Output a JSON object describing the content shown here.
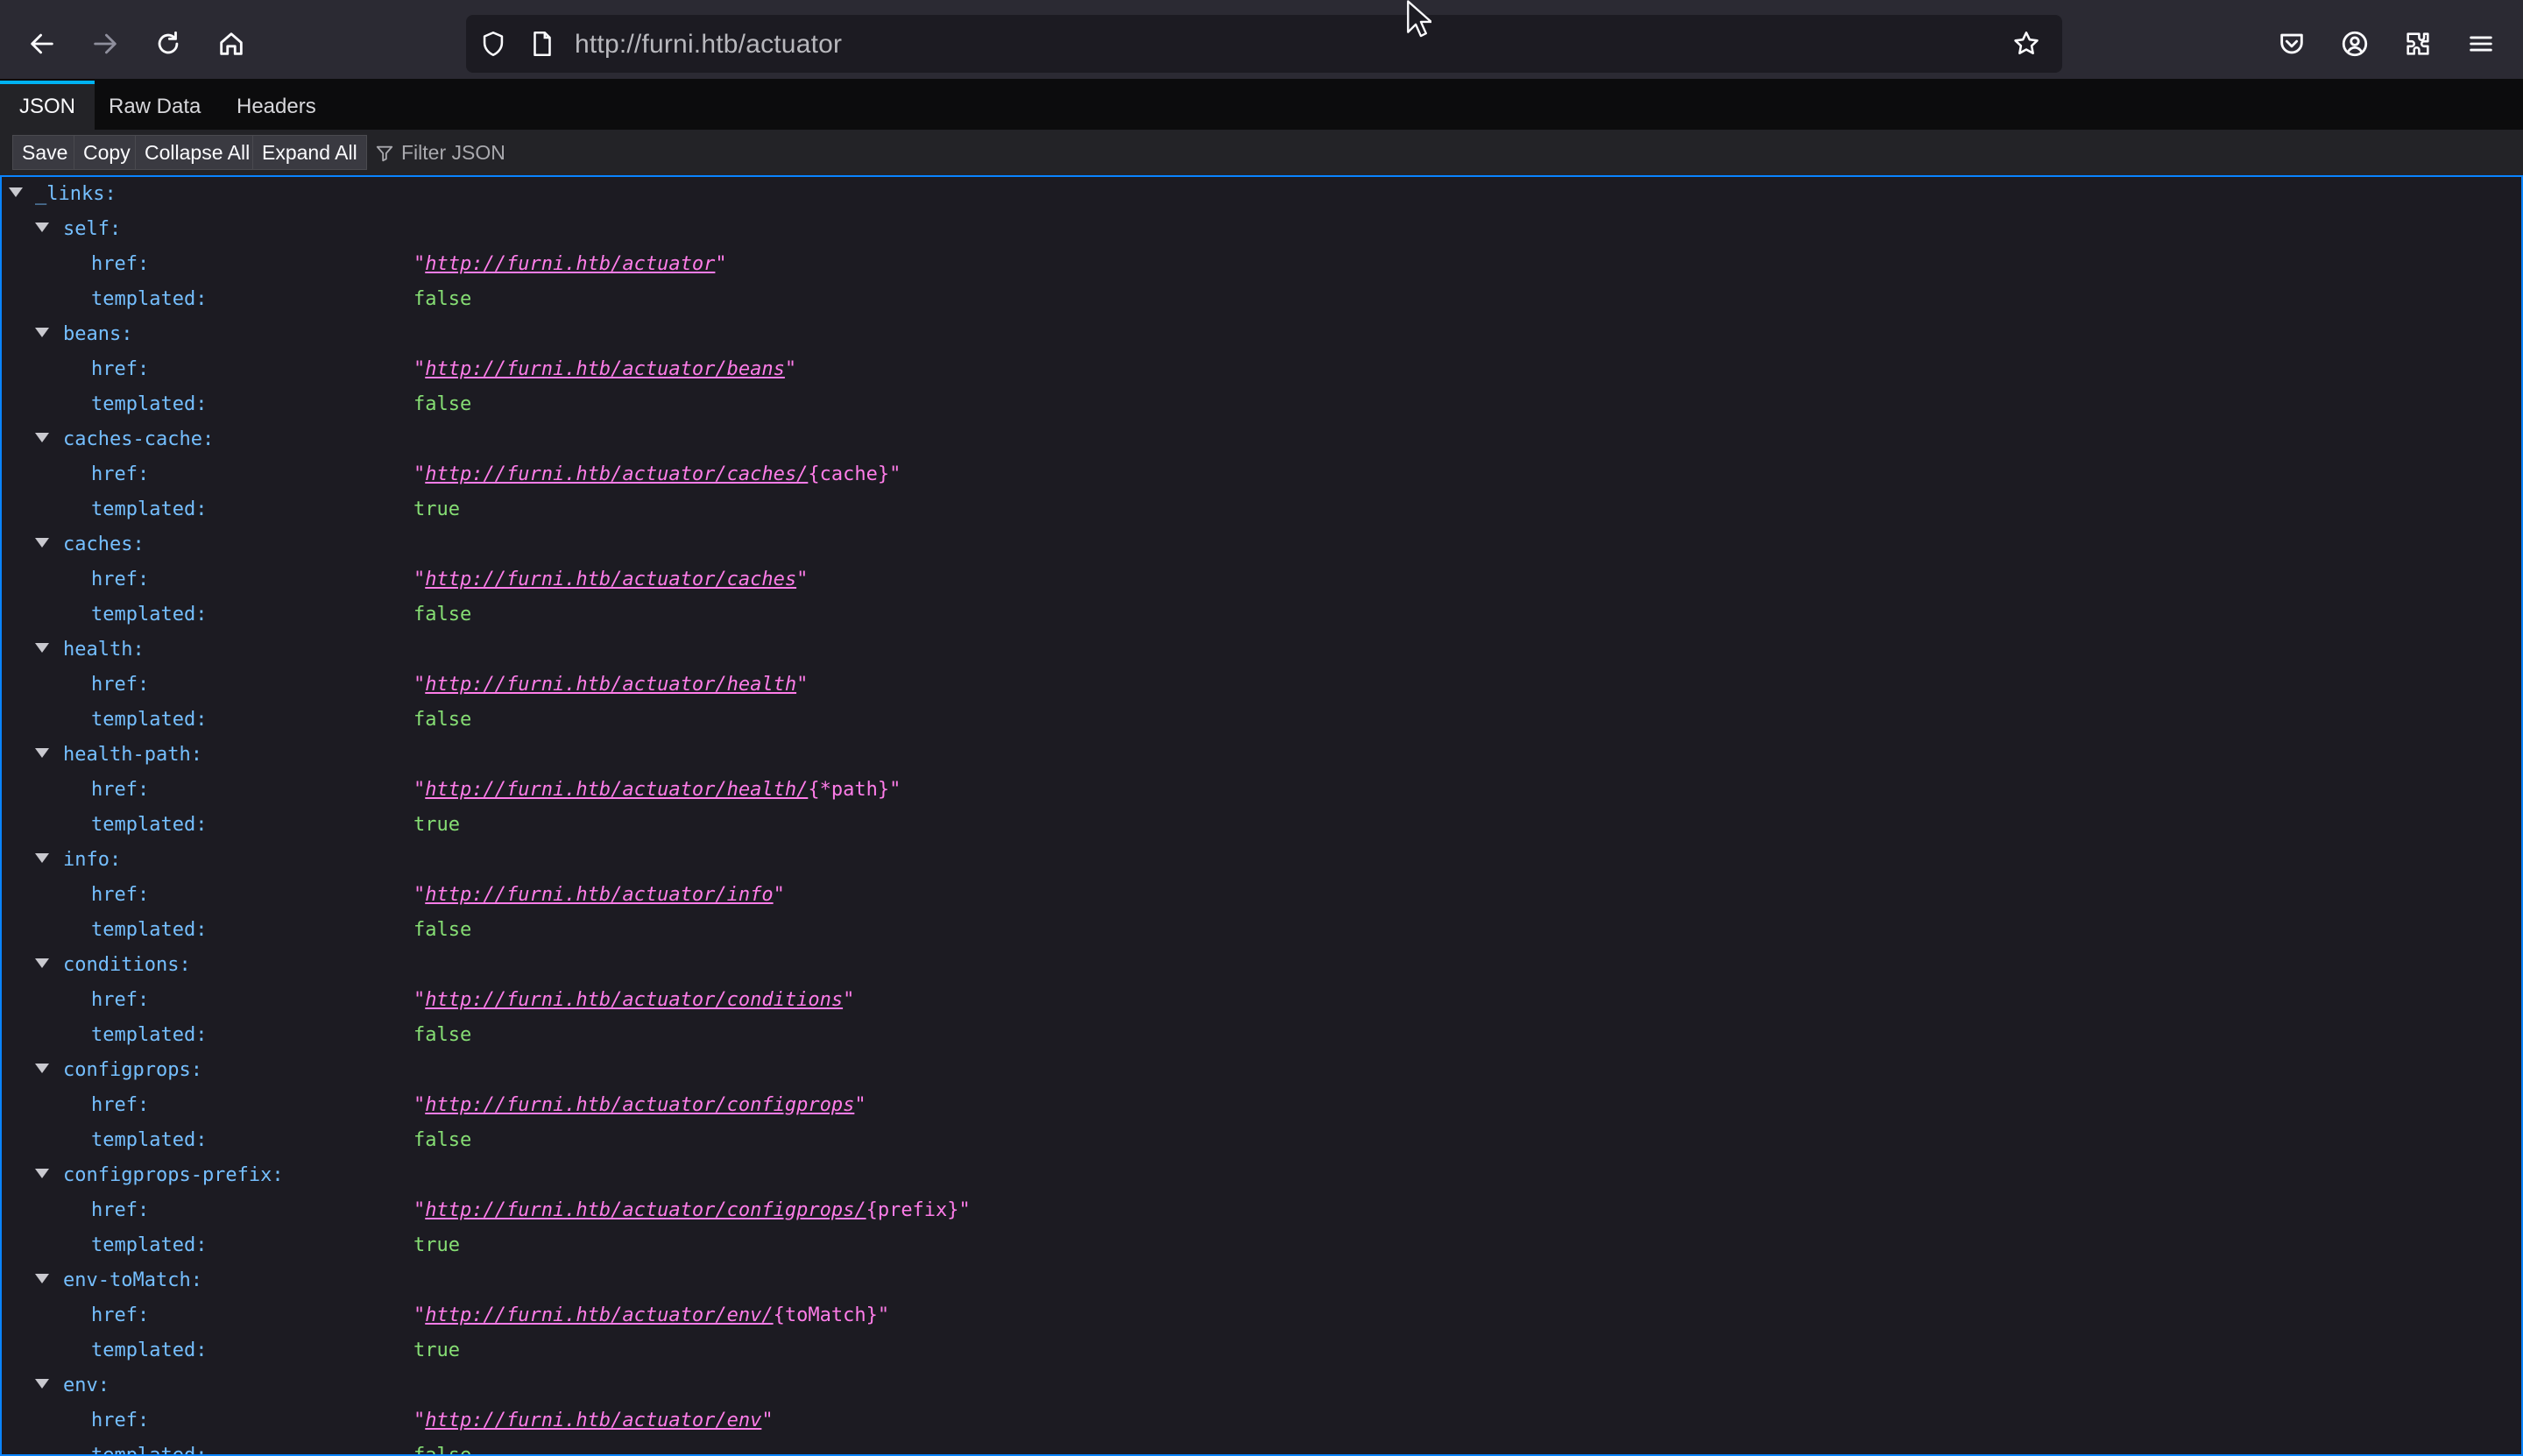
{
  "browser": {
    "url_host": "http://furni.htb",
    "url_path": "/actuator",
    "icons": [
      "back-arrow-icon",
      "forward-arrow-icon",
      "reload-icon",
      "home-icon",
      "shield-icon",
      "page-icon",
      "star-icon",
      "pocket-icon",
      "account-icon",
      "extensions-icon",
      "menu-icon"
    ]
  },
  "viewer": {
    "tabs": [
      "JSON",
      "Raw Data",
      "Headers"
    ],
    "active_tab": "JSON",
    "toolbar": {
      "save": "Save",
      "copy": "Copy",
      "collapse_all": "Collapse All",
      "expand_all": "Expand All",
      "filter_placeholder": "Filter JSON"
    }
  },
  "json": {
    "root_key": "_links:",
    "entries": [
      {
        "name": "self:",
        "href_link": "http://furni.htb/actuator",
        "href_tail": "",
        "templated": "false"
      },
      {
        "name": "beans:",
        "href_link": "http://furni.htb/actuator/beans",
        "href_tail": "",
        "templated": "false"
      },
      {
        "name": "caches-cache:",
        "href_link": "http://furni.htb/actuator/caches/",
        "href_tail": "{cache}",
        "templated": "true"
      },
      {
        "name": "caches:",
        "href_link": "http://furni.htb/actuator/caches",
        "href_tail": "",
        "templated": "false"
      },
      {
        "name": "health:",
        "href_link": "http://furni.htb/actuator/health",
        "href_tail": "",
        "templated": "false"
      },
      {
        "name": "health-path:",
        "href_link": "http://furni.htb/actuator/health/",
        "href_tail": "{*path}",
        "templated": "true"
      },
      {
        "name": "info:",
        "href_link": "http://furni.htb/actuator/info",
        "href_tail": "",
        "templated": "false"
      },
      {
        "name": "conditions:",
        "href_link": "http://furni.htb/actuator/conditions",
        "href_tail": "",
        "templated": "false"
      },
      {
        "name": "configprops:",
        "href_link": "http://furni.htb/actuator/configprops",
        "href_tail": "",
        "templated": "false"
      },
      {
        "name": "configprops-prefix:",
        "href_link": "http://furni.htb/actuator/configprops/",
        "href_tail": "{prefix}",
        "templated": "true"
      },
      {
        "name": "env-toMatch:",
        "href_link": "http://furni.htb/actuator/env/",
        "href_tail": "{toMatch}",
        "templated": "true"
      },
      {
        "name": "env:",
        "href_link": "http://furni.htb/actuator/env",
        "href_tail": "",
        "templated": "false"
      }
    ],
    "href_key": "href:",
    "templated_key": "templated:",
    "quote": "\""
  }
}
